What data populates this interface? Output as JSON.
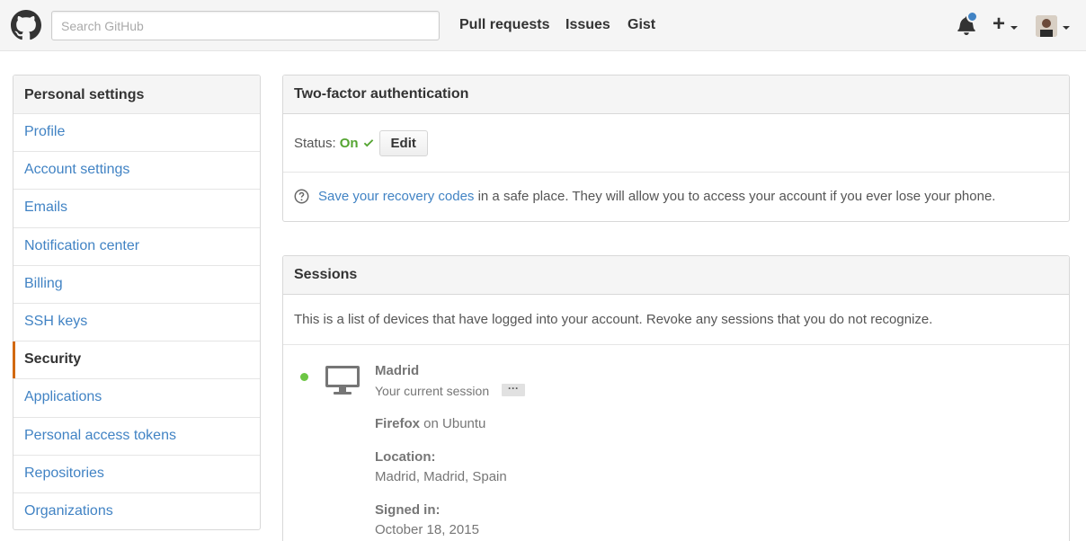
{
  "header": {
    "search_placeholder": "Search GitHub",
    "nav": [
      "Pull requests",
      "Issues",
      "Gist"
    ],
    "plus_label": "+"
  },
  "sidebar": {
    "title": "Personal settings",
    "items": [
      {
        "label": "Profile"
      },
      {
        "label": "Account settings"
      },
      {
        "label": "Emails"
      },
      {
        "label": "Notification center"
      },
      {
        "label": "Billing"
      },
      {
        "label": "SSH keys"
      },
      {
        "label": "Security",
        "selected": true
      },
      {
        "label": "Applications"
      },
      {
        "label": "Personal access tokens"
      },
      {
        "label": "Repositories"
      },
      {
        "label": "Organizations"
      }
    ]
  },
  "two_factor": {
    "title": "Two-factor authentication",
    "status_label": "Status:",
    "status_value": "On",
    "edit_label": "Edit",
    "recovery_link": "Save your recovery codes",
    "recovery_text": " in a safe place. They will allow you to access your account if you ever lose your phone."
  },
  "sessions": {
    "title": "Sessions",
    "description": "This is a list of devices that have logged into your account. Revoke any sessions that you do not recognize.",
    "current": {
      "name": "Madrid",
      "subtitle": "Your current session",
      "more_label": "···",
      "browser": "Firefox",
      "os_text": " on Ubuntu",
      "location_label": "Location:",
      "location_value": "Madrid, Madrid, Spain",
      "signed_in_label": "Signed in:",
      "signed_in_value": "October 18, 2015"
    }
  },
  "colors": {
    "link": "#4183c4",
    "status_on": "#55a532",
    "active_dot": "#6cc644",
    "selected_accent": "#d26911",
    "notification_dot": "#4183c4"
  }
}
